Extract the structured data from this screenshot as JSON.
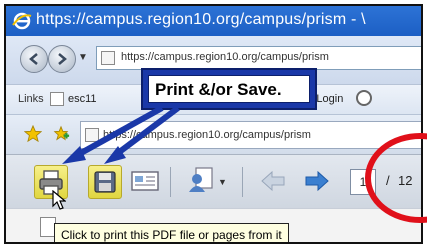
{
  "window": {
    "title": "https://campus.region10.org/campus/prism - \\"
  },
  "address_bar": {
    "url": "https://campus.region10.org/campus/prism"
  },
  "links_bar": {
    "label": "Links",
    "items": [
      {
        "label": "esc11"
      },
      {
        "label": "S Login"
      }
    ]
  },
  "tab": {
    "url": "https://campus.region10.org/campus/prism"
  },
  "pdf_toolbar": {
    "current_page": "1",
    "separator": "/",
    "total_pages": "12"
  },
  "callout": {
    "text": "Print &/or Save."
  },
  "tooltip": {
    "text": "Click to print this PDF file or pages from it"
  },
  "colors": {
    "title_bar": "#1c5fc4",
    "highlight": "#e0d640",
    "callout_border": "#1a38a8",
    "circle": "#e0101a"
  },
  "icons": {
    "title": "ie-logo-icon",
    "print": "printer-icon",
    "save": "floppy-disk-icon",
    "email": "email-icon",
    "review": "review-user-icon",
    "prev": "previous-page-arrow-icon",
    "next": "next-page-arrow-icon",
    "favorite": "star-icon",
    "add_favorite": "add-favorite-icon"
  }
}
